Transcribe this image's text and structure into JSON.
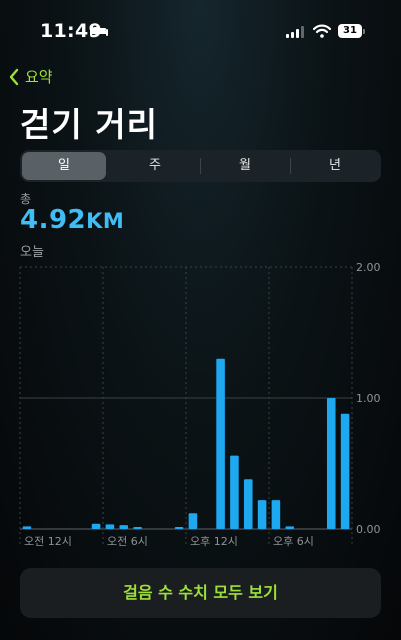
{
  "status_bar": {
    "time": "11:49",
    "battery": "31"
  },
  "nav": {
    "back_label": "요약"
  },
  "page": {
    "title": "걷기 거리"
  },
  "segments": {
    "items": [
      "일",
      "주",
      "월",
      "년"
    ],
    "selected": "일"
  },
  "summary": {
    "total_label": "총",
    "value": "4.92",
    "unit": "KM",
    "date_label": "오늘"
  },
  "accent_colors": {
    "bar": "#1ea8f0",
    "value": "#40bdf5",
    "link": "#9ee03a"
  },
  "chart_data": {
    "type": "bar",
    "x_unit": "hour",
    "x_labels": [
      "오전 12시",
      "오전 6시",
      "오후 12시",
      "오후 6시"
    ],
    "y_ticks": [
      "2.00",
      "1.00",
      "0.00"
    ],
    "ylim": [
      0,
      2
    ],
    "grid": true,
    "series": [
      {
        "values": [
          0.02,
          0,
          0,
          0,
          0,
          0.04,
          0.035,
          0.03,
          0.015,
          0,
          0,
          0.015,
          0.12,
          0,
          1.3,
          0.56,
          0.38,
          0.22,
          0.22,
          0.02,
          0,
          0,
          1.0,
          0.88
        ]
      }
    ]
  },
  "cta": {
    "label": "걸음 수 수치 모두 보기"
  }
}
